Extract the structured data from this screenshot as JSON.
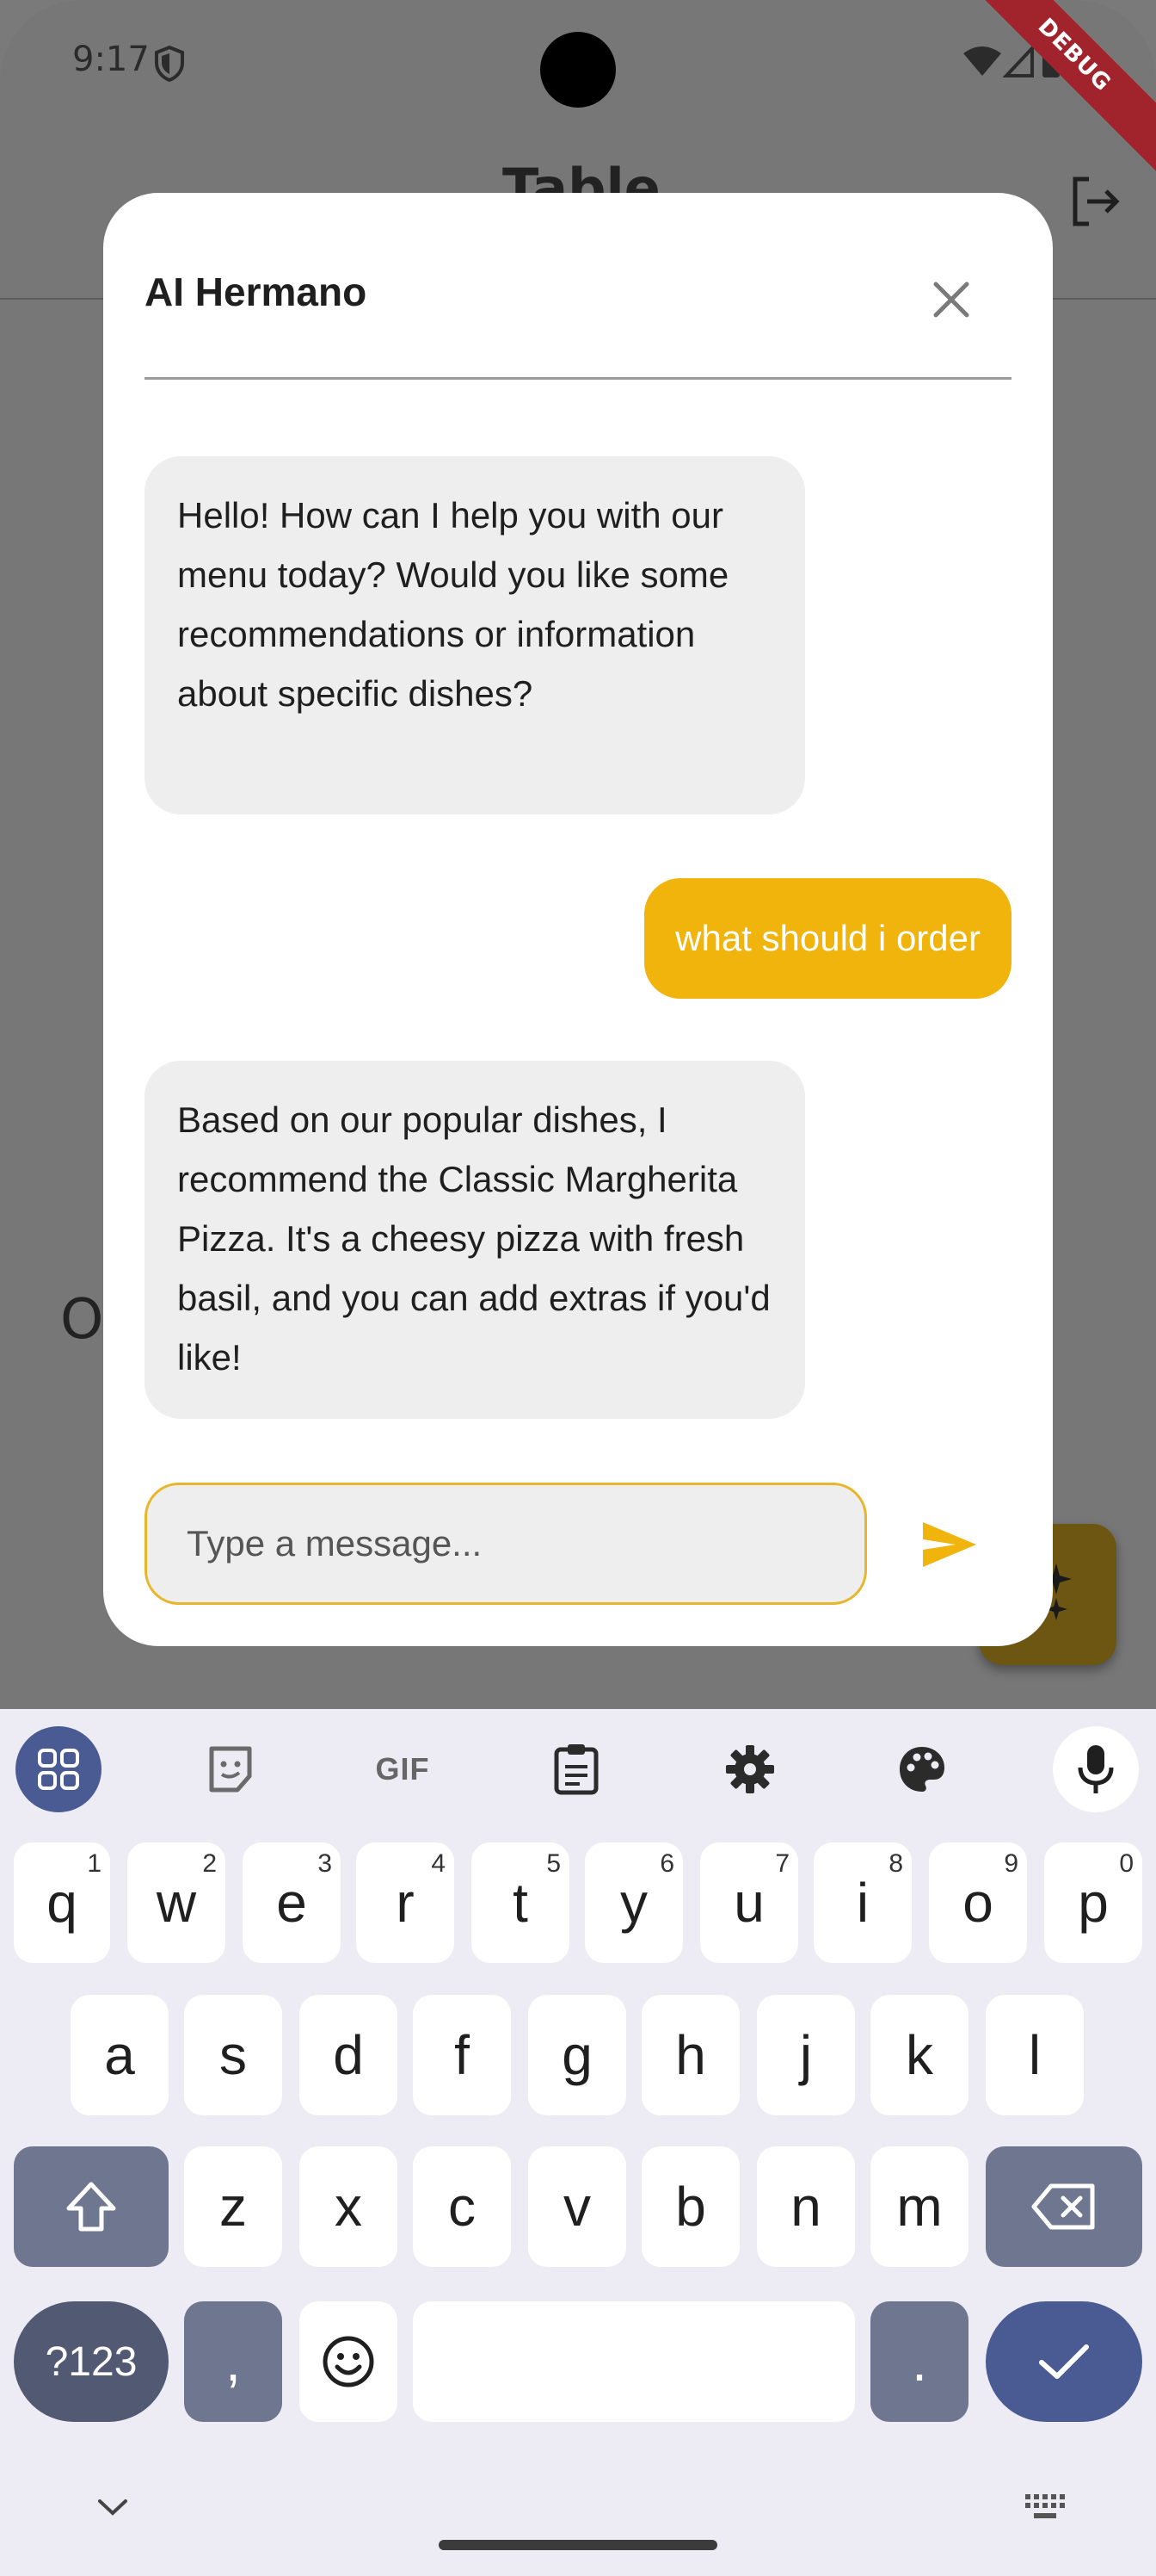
{
  "status_bar": {
    "time": "9:17",
    "debug_label": "DEBUG"
  },
  "app_bar": {
    "title": "Table"
  },
  "background": {
    "partial_text": "O"
  },
  "dialog": {
    "title": "AI Hermano",
    "messages": [
      {
        "sender": "bot",
        "text": "Hello! How can I help you with our menu today? Would you like some recommendations or information about specific dishes?"
      },
      {
        "sender": "user",
        "text": "what should i order"
      },
      {
        "sender": "bot",
        "text": "Based on our popular dishes, I recommend the Classic Margherita Pizza. It's a cheesy pizza with fresh basil, and you can add extras if you'd like!"
      }
    ],
    "input": {
      "placeholder": "Type a message...",
      "value": ""
    }
  },
  "keyboard": {
    "toolbar": {
      "gif_label": "GIF"
    },
    "row1": [
      {
        "key": "q",
        "hint": "1"
      },
      {
        "key": "w",
        "hint": "2"
      },
      {
        "key": "e",
        "hint": "3"
      },
      {
        "key": "r",
        "hint": "4"
      },
      {
        "key": "t",
        "hint": "5"
      },
      {
        "key": "y",
        "hint": "6"
      },
      {
        "key": "u",
        "hint": "7"
      },
      {
        "key": "i",
        "hint": "8"
      },
      {
        "key": "o",
        "hint": "9"
      },
      {
        "key": "p",
        "hint": "0"
      }
    ],
    "row2": [
      "a",
      "s",
      "d",
      "f",
      "g",
      "h",
      "j",
      "k",
      "l"
    ],
    "row3": [
      "z",
      "x",
      "c",
      "v",
      "b",
      "n",
      "m"
    ],
    "row4": {
      "symbols": "?123",
      "comma": ",",
      "period": "."
    }
  },
  "colors": {
    "accent": "#f0b40c",
    "bot_bubble": "#eeeeee",
    "keyboard_primary": "#4a5a92",
    "keyboard_modifier": "#6f7690"
  }
}
